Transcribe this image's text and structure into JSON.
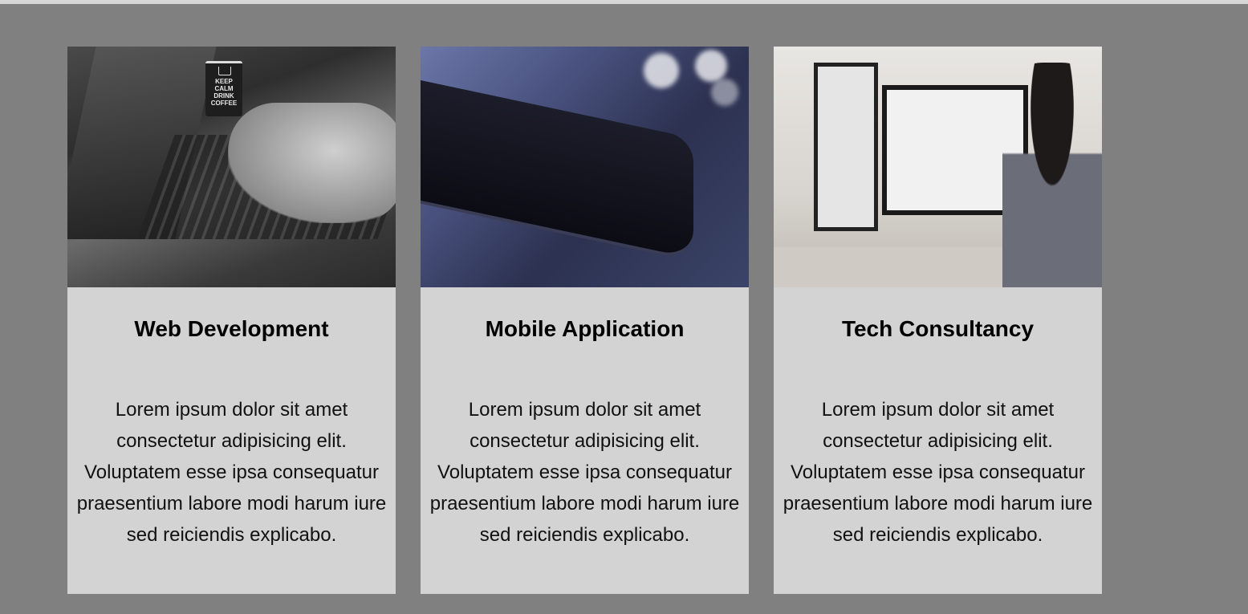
{
  "cards": [
    {
      "title": "Web Development",
      "description": "Lorem ipsum dolor sit amet consectetur adipisicing elit. Voluptatem esse ipsa consequatur praesentium labore modi harum iure sed reiciendis explicabo.",
      "image": "laptop-typing-photo",
      "image_text": "KEEP CALM DRINK COFFEE"
    },
    {
      "title": "Mobile Application",
      "description": "Lorem ipsum dolor sit amet consectetur adipisicing elit. Voluptatem esse ipsa consequatur praesentium labore modi harum iure sed reiciendis explicabo.",
      "image": "smartphone-photo"
    },
    {
      "title": "Tech Consultancy",
      "description": "Lorem ipsum dolor sit amet consectetur adipisicing elit. Voluptatem esse ipsa consequatur praesentium labore modi harum iure sed reiciendis explicabo.",
      "image": "office-workstation-photo"
    }
  ],
  "colors": {
    "background": "#808080",
    "card": "#d3d3d3",
    "topbar": "#d6d6d6"
  }
}
